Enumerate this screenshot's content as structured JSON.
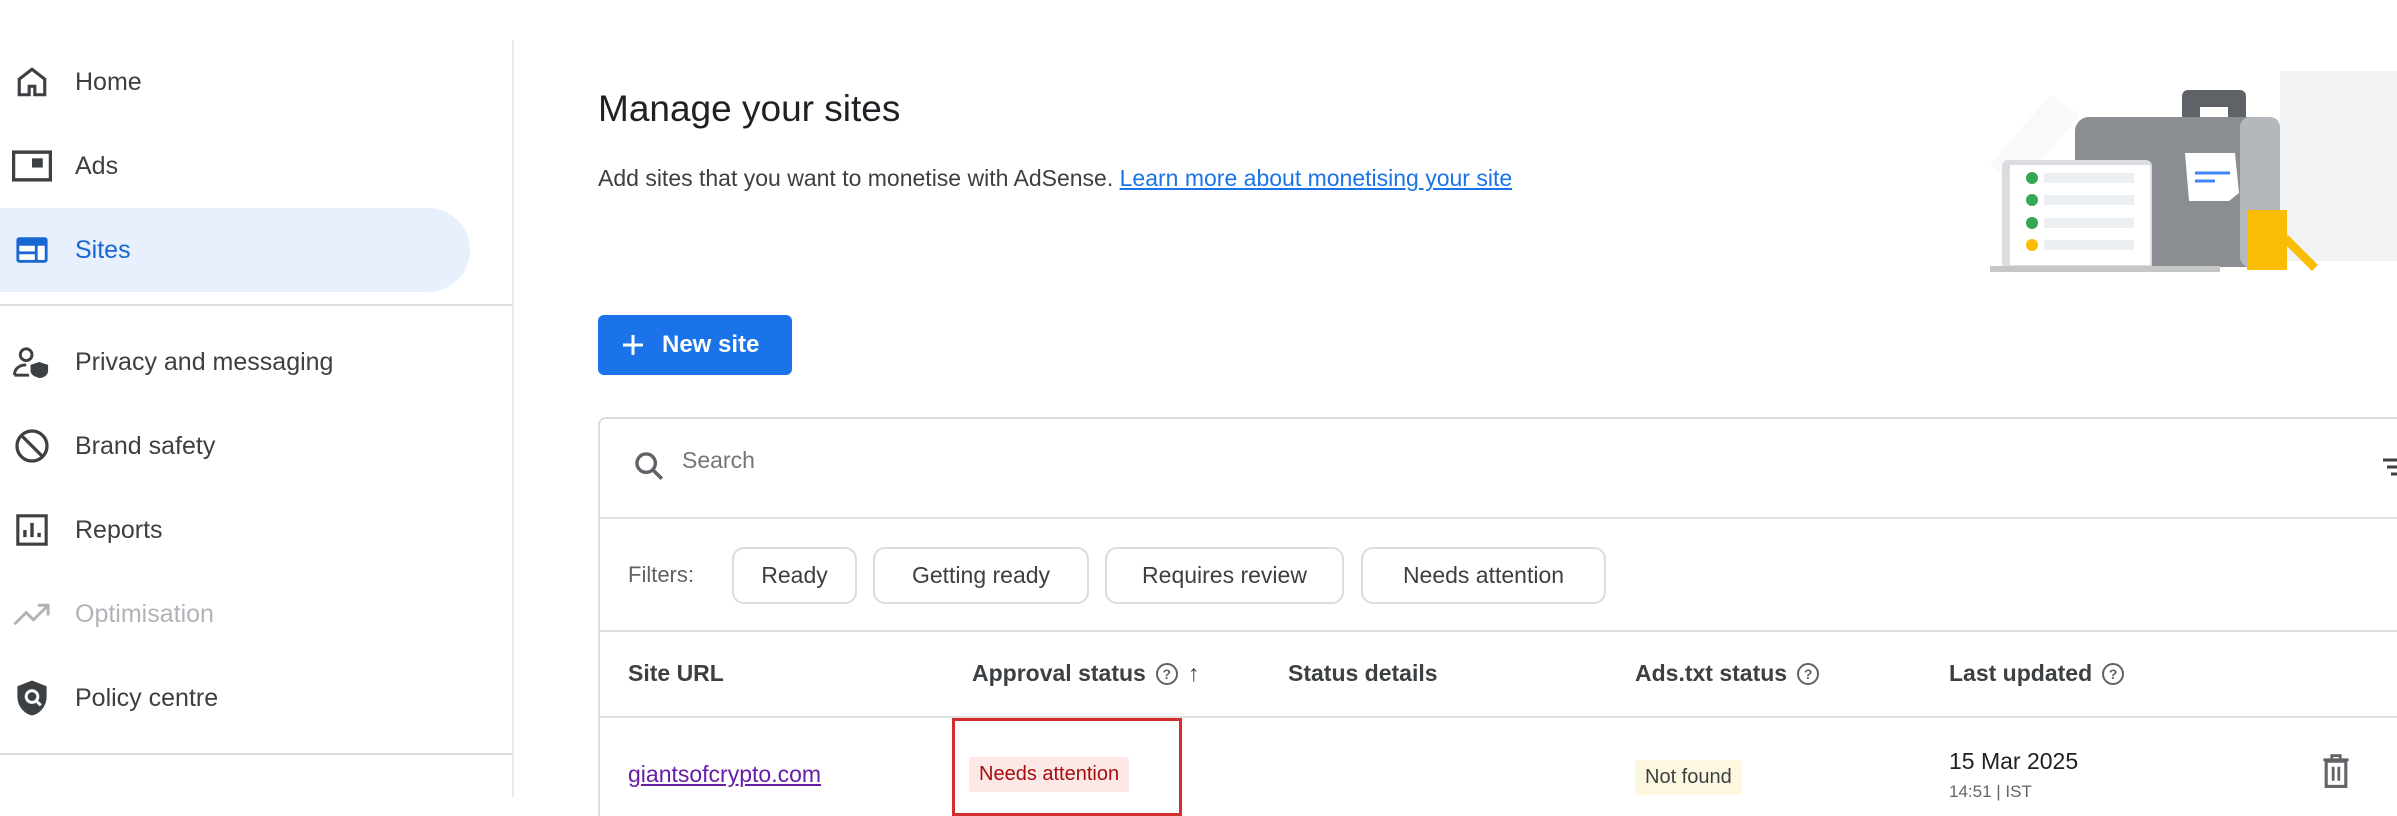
{
  "sidebar": {
    "items": [
      {
        "label": "Home",
        "icon": "home-icon"
      },
      {
        "label": "Ads",
        "icon": "ads-icon"
      },
      {
        "label": "Sites",
        "icon": "sites-icon",
        "active": true
      },
      {
        "label": "Privacy and messaging",
        "icon": "privacy-icon"
      },
      {
        "label": "Brand safety",
        "icon": "block-icon"
      },
      {
        "label": "Reports",
        "icon": "reports-icon"
      },
      {
        "label": "Optimisation",
        "icon": "trending-icon",
        "disabled": true
      },
      {
        "label": "Policy centre",
        "icon": "policy-icon"
      }
    ]
  },
  "main": {
    "title": "Manage your sites",
    "subtitle": "Add sites that you want to monetise with AdSense.",
    "learn_more": "Learn more about monetising your site",
    "new_site": "New site",
    "search_placeholder": "Search",
    "filters_label": "Filters:",
    "filters": [
      "Ready",
      "Getting ready",
      "Requires review",
      "Needs attention"
    ],
    "columns": [
      "Site URL",
      "Approval status",
      "Status details",
      "Ads.txt status",
      "Last updated"
    ],
    "rows": [
      {
        "site_url": "giantsofcrypto.com",
        "approval_status": "Needs attention",
        "status_details": "",
        "ads_txt": "Not found",
        "date": "15 Mar 2025",
        "time": "14:51 | IST"
      }
    ]
  },
  "colors": {
    "accent": "#1a73e8",
    "active_bg": "#e8f0fe",
    "error_bg": "#fce8e6",
    "warn_bg": "#fef7e0",
    "highlight": "#d32f2f"
  }
}
